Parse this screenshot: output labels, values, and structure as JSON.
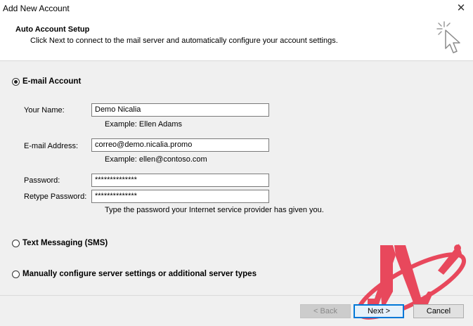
{
  "window": {
    "title": "Add New Account",
    "close_glyph": "✕"
  },
  "header": {
    "title": "Auto Account Setup",
    "description": "Click Next to connect to the mail server and automatically configure your account settings.",
    "icon": "wizard-cursor-icon"
  },
  "options": {
    "email": {
      "label": "E-mail Account",
      "selected": true
    },
    "sms": {
      "label": "Text Messaging (SMS)",
      "selected": false
    },
    "manual": {
      "label": "Manually configure server settings or additional server types",
      "selected": false
    }
  },
  "form": {
    "name_label": "Your Name:",
    "name_value": "Demo Nicalia",
    "name_hint": "Example: Ellen Adams",
    "email_label": "E-mail Address:",
    "email_value": "correo@demo.nicalia.promo",
    "email_hint": "Example: ellen@contoso.com",
    "password_label": "Password:",
    "password_value": "**************",
    "retype_label": "Retype Password:",
    "retype_value": "**************",
    "password_hint": "Type the password your Internet service provider has given you."
  },
  "buttons": {
    "back": "< Back",
    "next": "Next >",
    "cancel": "Cancel"
  },
  "colors": {
    "logo_red": "#e8485c",
    "focus_blue": "#0078d7"
  }
}
